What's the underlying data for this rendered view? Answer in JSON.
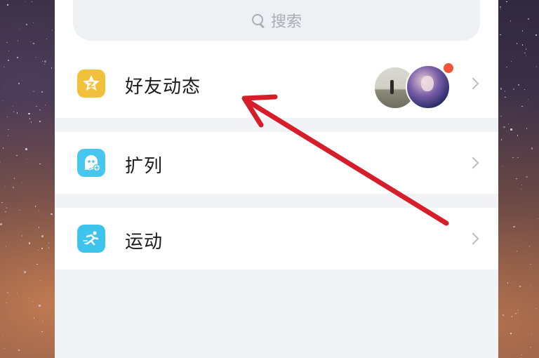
{
  "search": {
    "placeholder": "搜索"
  },
  "items": [
    {
      "label": "好友动态",
      "icon": "friends-feed-star-icon",
      "icon_color": "#f2c13b",
      "has_notification": true,
      "avatars": 2
    },
    {
      "label": "扩列",
      "icon": "ghost-plus-icon",
      "icon_color": "#47c6ee"
    },
    {
      "label": "运动",
      "icon": "running-icon",
      "icon_color": "#3ec4ec"
    }
  ],
  "colors": {
    "notification_dot": "#f2563a",
    "annotation_arrow": "#d61e2b"
  }
}
